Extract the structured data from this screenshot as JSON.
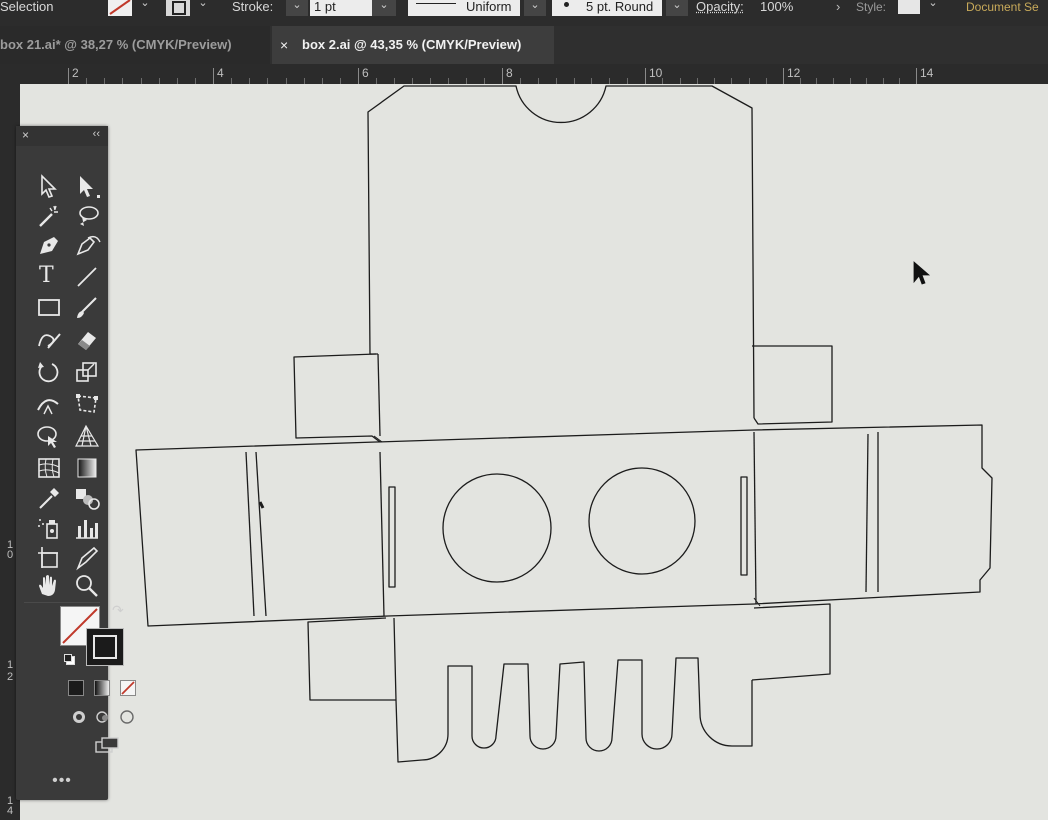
{
  "control_bar": {
    "selection_label": "Selection",
    "stroke_label": "Stroke:",
    "stroke_weight": "1 pt",
    "profile_label": "Uniform",
    "brush_label": "5 pt. Round",
    "opacity_label": "Opacity:",
    "opacity_value": "100%",
    "style_label": "Style:",
    "document_setup_label": "Document Se"
  },
  "tabs": [
    {
      "label": "box 21.ai* @ 38,27 % (CMYK/Preview)",
      "active": false
    },
    {
      "label": "box 2.ai @ 43,35 % (CMYK/Preview)",
      "active": true
    }
  ],
  "tab_close_glyph": "×",
  "ruler_top": {
    "labels": [
      "2",
      "4",
      "6",
      "8",
      "10",
      "12",
      "14"
    ]
  },
  "ruler_left": {
    "labels": [
      "1",
      "0",
      "1",
      "2",
      "1",
      "4"
    ]
  },
  "toolbar": {
    "close_glyph": "×",
    "collapse_glyph": "‹‹",
    "more_glyph": "•••",
    "type_tool_glyph": "T"
  },
  "colors": {
    "canvas": "#e3e4e0",
    "ui_dark": "#2c2c2c",
    "stroke": "#1c1c1c"
  }
}
